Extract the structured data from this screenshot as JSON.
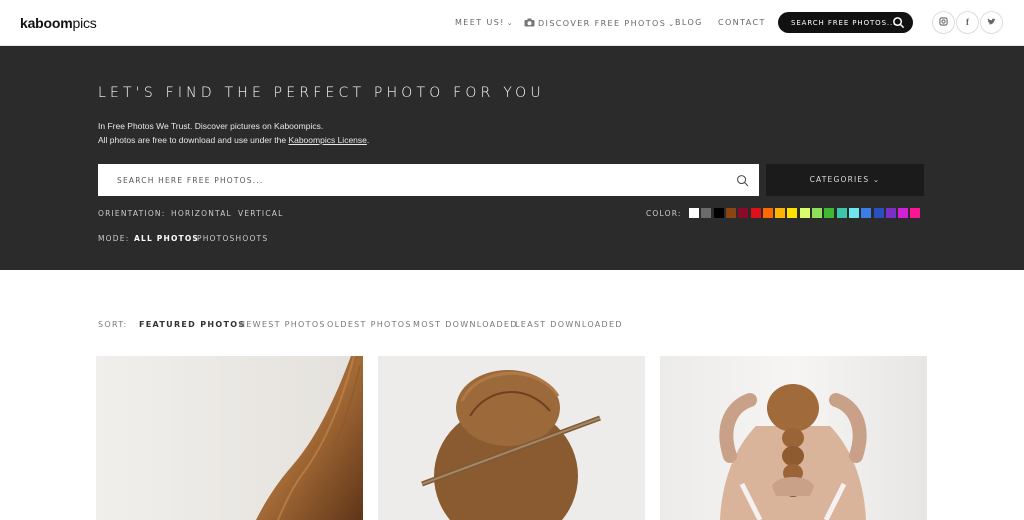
{
  "header": {
    "logo_bold": "kaboom",
    "logo_light": "pics",
    "nav": [
      {
        "label": "MEET US!",
        "caret": "⌄"
      },
      {
        "label": "DISCOVER FREE PHOTOS",
        "caret": "⌄"
      },
      {
        "label": "BLOG"
      },
      {
        "label": "CONTACT"
      }
    ],
    "search_label": "SEARCH FREE PHOTOS...",
    "social": [
      "instagram-icon",
      "facebook-icon",
      "twitter-icon"
    ]
  },
  "hero": {
    "title": "LET'S FIND THE PERFECT PHOTO FOR YOU",
    "line1": "In Free Photos We Trust. Discover pictures on Kaboompics.",
    "line2_prefix": "All photos are free to download and use under the ",
    "line2_link": "Kaboompics License",
    "line2_suffix": ".",
    "search_placeholder": "SEARCH HERE FREE PHOTOS...",
    "categories_label": "CATEGORIES ⌄",
    "orientation_label": "ORIENTATION:",
    "orientation_options": [
      "HORIZONTAL",
      "VERTICAL"
    ],
    "mode_label": "MODE:",
    "mode_options": [
      "ALL PHOTOS",
      "PHOTOSHOOTS"
    ],
    "mode_active": "ALL PHOTOS",
    "color_label": "COLOR:",
    "colors": [
      "#ffffff",
      "#6b6b6b",
      "#000000",
      "#8b4513",
      "#8b0a2a",
      "#e0101a",
      "#ff6a00",
      "#ffb400",
      "#ffe100",
      "#d8ff6a",
      "#8ee05a",
      "#3fb832",
      "#3ec6a8",
      "#6ee6f0",
      "#3a7ee8",
      "#2a4fc0",
      "#7a30c8",
      "#d020d8",
      "#ff1493"
    ]
  },
  "sort": {
    "label": "SORT:",
    "options": [
      "FEATURED PHOTOS",
      "NEWEST PHOTOS",
      "OLDEST PHOTOS",
      "MOST DOWNLOADED",
      "LEAST DOWNLOADED"
    ],
    "active": "FEATURED PHOTOS"
  },
  "photos": [
    {
      "name": "photo-long-hair"
    },
    {
      "name": "photo-hair-bun-stick"
    },
    {
      "name": "photo-braid-back"
    }
  ]
}
